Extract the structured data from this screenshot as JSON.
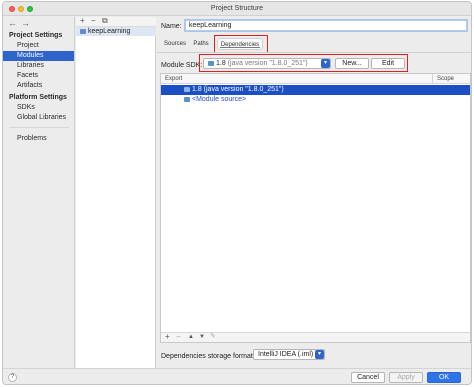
{
  "window": {
    "title": "Project Structure"
  },
  "nav": {
    "back_arrow": "←",
    "forward_arrow": "→",
    "project_settings_header": "Project Settings",
    "project_settings_items": [
      "Project",
      "Modules",
      "Libraries",
      "Facets",
      "Artifacts"
    ],
    "platform_settings_header": "Platform Settings",
    "platform_settings_items": [
      "SDKs",
      "Global Libraries"
    ],
    "problems": "Problems"
  },
  "modules": {
    "tools": [
      "+",
      "−",
      "⧉"
    ],
    "items": [
      "keepLearning"
    ]
  },
  "module": {
    "name_label": "Name:",
    "name_value": "keepLearning",
    "tabs": [
      "Sources",
      "Paths",
      "Dependencies"
    ],
    "active_tab": "Dependencies",
    "sdk_label": "Module SDK:",
    "sdk_value": "1.8",
    "sdk_detail": "(java version \"1.8.0_251\")",
    "new_button": "New...",
    "edit_button": "Edit"
  },
  "dependencies_table": {
    "columns": [
      "Export",
      "Scope"
    ],
    "rows": [
      {
        "label": "1.8 (java version \"1.8.0_251\")",
        "selected": true
      },
      {
        "label": "<Module source>",
        "selected": false
      }
    ],
    "footer_tools": [
      "+",
      "−",
      "▲",
      "▼",
      "✎"
    ]
  },
  "storage": {
    "label": "Dependencies storage format:",
    "value": "IntelliJ IDEA (.iml)"
  },
  "footer": {
    "help": "?",
    "cancel": "Cancel",
    "apply": "Apply",
    "ok": "OK"
  },
  "colors": {
    "selection": "#2f65ca",
    "highlight_box": "#e02020",
    "primary_button": "#2f74e6"
  }
}
